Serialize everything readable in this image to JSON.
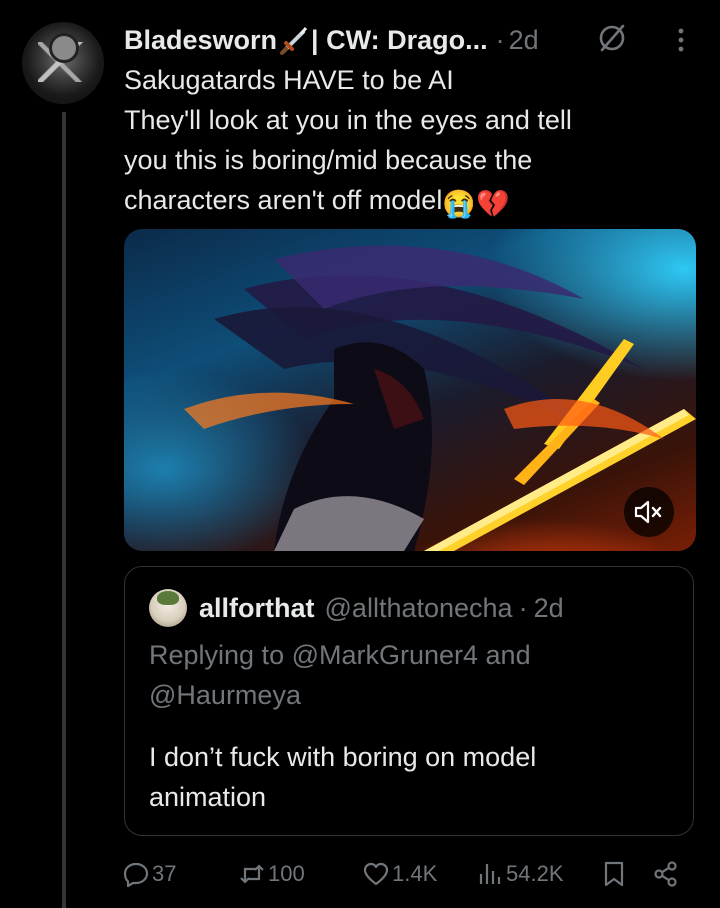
{
  "post": {
    "author_name": "Bladesworn",
    "author_suffix": "| CW: Drago...",
    "dot": "·",
    "time": "2d",
    "text_lines": [
      "Sakugatards HAVE to be AI",
      "They'll look at you in the eyes and tell",
      "you this is boring/mid because the",
      "characters aren't off model"
    ],
    "emoji": [
      "😭",
      "💔"
    ]
  },
  "media": {
    "mute_icon": "speaker-muted-icon"
  },
  "quote": {
    "name": "allforthat",
    "handle": "@allthatonecha",
    "dot": "·",
    "time": "2d",
    "reply_line1": "Replying to @MarkGruner4 and",
    "reply_line2": "@Haurmeya",
    "text_line1": "I don’t fuck with boring on model",
    "text_line2": "animation"
  },
  "actions": {
    "replies": "37",
    "reposts": "100",
    "likes": "1.4K",
    "views": "54.2K"
  },
  "colors": {
    "background": "#000000",
    "text": "#e7e9ea",
    "secondary": "#71767b",
    "border": "#2f3336"
  }
}
